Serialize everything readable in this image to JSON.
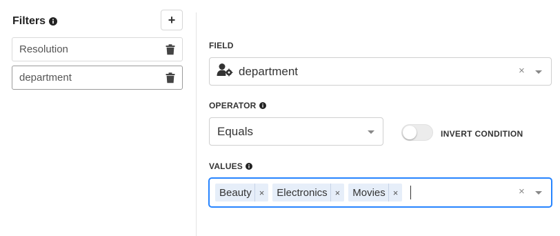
{
  "sidebar": {
    "title": "Filters",
    "add_label": "+",
    "items": [
      {
        "label": "Resolution",
        "active": false
      },
      {
        "label": "department",
        "active": true
      }
    ]
  },
  "field": {
    "label": "FIELD",
    "value": "department",
    "icon": "user-gear-icon",
    "clear": "×"
  },
  "operator": {
    "label": "OPERATOR",
    "value": "Equals"
  },
  "invert": {
    "label": "INVERT CONDITION",
    "enabled": false
  },
  "values": {
    "label": "VALUES",
    "chips": [
      {
        "label": "Beauty",
        "remove": "×"
      },
      {
        "label": "Electronics",
        "remove": "×"
      },
      {
        "label": "Movies",
        "remove": "×"
      }
    ],
    "clear": "×"
  },
  "colors": {
    "focus": "#2684ff",
    "chip_bg": "#e6eef9"
  }
}
